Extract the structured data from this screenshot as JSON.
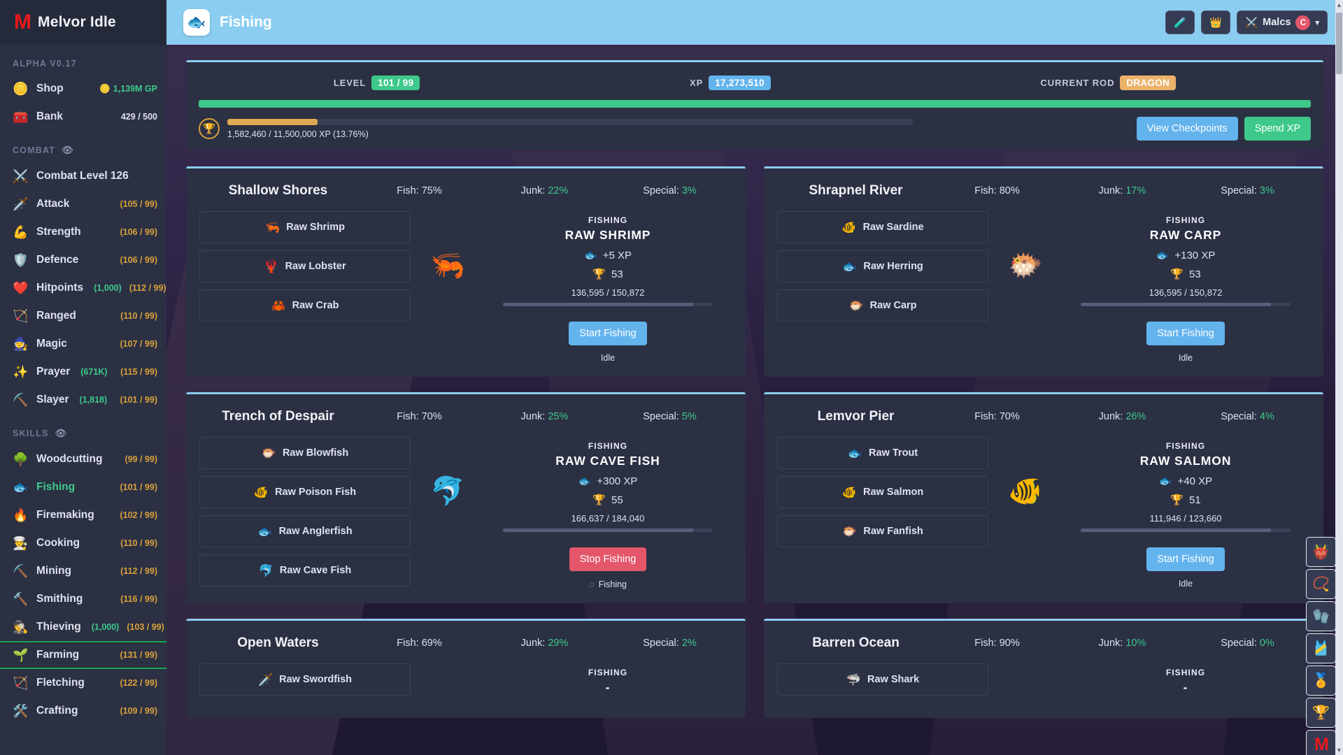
{
  "sidebar": {
    "brand": {
      "logo": "M",
      "title": "Melvor Idle"
    },
    "version": "ALPHA V0.17",
    "top_items": [
      {
        "icon": "🪙",
        "label": "Shop",
        "value": "1,139M GP",
        "value_icon": "🪙",
        "value_kind": "gp"
      },
      {
        "icon": "🧰",
        "label": "Bank",
        "value": "429 / 500",
        "value_kind": "count"
      }
    ],
    "combat_header": "COMBAT",
    "combat_items": [
      {
        "icon": "⚔️",
        "label": "Combat Level 126",
        "level": ""
      },
      {
        "icon": "🗡️",
        "label": "Attack",
        "level": "(105 / 99)"
      },
      {
        "icon": "💪",
        "label": "Strength",
        "level": "(106 / 99)"
      },
      {
        "icon": "🛡️",
        "label": "Defence",
        "level": "(106 / 99)"
      },
      {
        "icon": "❤️",
        "label": "Hitpoints",
        "mastery": "(1,000)",
        "level": "(112 / 99)"
      },
      {
        "icon": "🏹",
        "label": "Ranged",
        "level": "(110 / 99)"
      },
      {
        "icon": "🧙",
        "label": "Magic",
        "level": "(107 / 99)"
      },
      {
        "icon": "✨",
        "label": "Prayer",
        "mastery": "(671K)",
        "level": "(115 / 99)"
      },
      {
        "icon": "⛏️",
        "label": "Slayer",
        "mastery": "(1,818)",
        "level": "(101 / 99)"
      }
    ],
    "skills_header": "SKILLS",
    "skill_items": [
      {
        "icon": "🌳",
        "label": "Woodcutting",
        "level": "(99 / 99)"
      },
      {
        "icon": "🐟",
        "label": "Fishing",
        "level": "(101 / 99)",
        "selected": true
      },
      {
        "icon": "🔥",
        "label": "Firemaking",
        "level": "(102 / 99)"
      },
      {
        "icon": "👨‍🍳",
        "label": "Cooking",
        "level": "(110 / 99)"
      },
      {
        "icon": "⛏️",
        "label": "Mining",
        "level": "(112 / 99)"
      },
      {
        "icon": "🔨",
        "label": "Smithing",
        "level": "(116 / 99)"
      },
      {
        "icon": "🕵️",
        "label": "Thieving",
        "mastery": "(1,000)",
        "level": "(103 / 99)"
      },
      {
        "icon": "🌱",
        "label": "Farming",
        "level": "(131 / 99)",
        "active": true
      },
      {
        "icon": "🏹",
        "label": "Fletching",
        "level": "(122 / 99)"
      },
      {
        "icon": "🛠️",
        "label": "Crafting",
        "level": "(109 / 99)"
      }
    ]
  },
  "topbar": {
    "page_icon": "🐟",
    "page_title": "Fishing",
    "potion_button": "🧪",
    "crown_button": "👑",
    "account_icon": "⚔️",
    "account_name": "Malcs",
    "account_badge": "C",
    "caret": "▾"
  },
  "xp_panel": {
    "level_label": "LEVEL",
    "level_value": "101 / 99",
    "xp_label": "XP",
    "xp_value": "17,273,510",
    "rod_label": "CURRENT ROD",
    "rod_value": "DRAGON",
    "bar_percent": 100,
    "mastery_icon": "🏆",
    "mastery_text": "1,582,460 / 11,500,000 XP (13.76%)",
    "mastery_percent": 13.76,
    "view_checkpoints": "View Checkpoints",
    "spend_xp": "Spend XP"
  },
  "areas": [
    {
      "name": "Shallow Shores",
      "fish_label": "Fish:",
      "fish_value": "75%",
      "junk_label": "Junk:",
      "junk_value": "22%",
      "special_label": "Special:",
      "special_value": "3%",
      "fishes": [
        {
          "icon": "🦐",
          "label": "Raw Shrimp"
        },
        {
          "icon": "🦞",
          "label": "Raw Lobster"
        },
        {
          "icon": "🦀",
          "label": "Raw Crab"
        }
      ],
      "big_icon": "🦐",
      "kicker": "FISHING",
      "selected_name": "RAW SHRIMP",
      "xp_icon": "🐟",
      "xp_text": "+5 XP",
      "mastery_icon": "🏆",
      "mastery_level": "53",
      "mastery_progress": "136,595 / 150,872",
      "mastery_percent": 90.5,
      "button_label": "Start Fishing",
      "button_kind": "blue",
      "status": "Idle",
      "status_spinner": false
    },
    {
      "name": "Shrapnel River",
      "fish_label": "Fish:",
      "fish_value": "80%",
      "junk_label": "Junk:",
      "junk_value": "17%",
      "special_label": "Special:",
      "special_value": "3%",
      "fishes": [
        {
          "icon": "🐠",
          "label": "Raw Sardine"
        },
        {
          "icon": "🐟",
          "label": "Raw Herring"
        },
        {
          "icon": "🐡",
          "label": "Raw Carp"
        }
      ],
      "big_icon": "🐡",
      "kicker": "FISHING",
      "selected_name": "RAW CARP",
      "xp_icon": "🐟",
      "xp_text": "+130 XP",
      "mastery_icon": "🏆",
      "mastery_level": "53",
      "mastery_progress": "136,595 / 150,872",
      "mastery_percent": 90.5,
      "button_label": "Start Fishing",
      "button_kind": "blue",
      "status": "Idle",
      "status_spinner": false
    },
    {
      "name": "Trench of Despair",
      "fish_label": "Fish:",
      "fish_value": "70%",
      "junk_label": "Junk:",
      "junk_value": "25%",
      "special_label": "Special:",
      "special_value": "5%",
      "fishes": [
        {
          "icon": "🐡",
          "label": "Raw Blowfish"
        },
        {
          "icon": "🐠",
          "label": "Raw Poison Fish"
        },
        {
          "icon": "🐟",
          "label": "Raw Anglerfish"
        },
        {
          "icon": "🐬",
          "label": "Raw Cave Fish"
        }
      ],
      "big_icon": "🐬",
      "kicker": "FISHING",
      "selected_name": "RAW CAVE FISH",
      "xp_icon": "🐟",
      "xp_text": "+300 XP",
      "mastery_icon": "🏆",
      "mastery_level": "55",
      "mastery_progress": "166,637 / 184,040",
      "mastery_percent": 90.5,
      "button_label": "Stop Fishing",
      "button_kind": "red",
      "status": "Fishing",
      "status_spinner": true
    },
    {
      "name": "Lemvor Pier",
      "fish_label": "Fish:",
      "fish_value": "70%",
      "junk_label": "Junk:",
      "junk_value": "26%",
      "special_label": "Special:",
      "special_value": "4%",
      "fishes": [
        {
          "icon": "🐟",
          "label": "Raw Trout"
        },
        {
          "icon": "🐠",
          "label": "Raw Salmon"
        },
        {
          "icon": "🐡",
          "label": "Raw Fanfish"
        }
      ],
      "big_icon": "🐠",
      "kicker": "FISHING",
      "selected_name": "RAW SALMON",
      "xp_icon": "🐟",
      "xp_text": "+40 XP",
      "mastery_icon": "🏆",
      "mastery_level": "51",
      "mastery_progress": "111,946 / 123,660",
      "mastery_percent": 90.5,
      "button_label": "Start Fishing",
      "button_kind": "blue",
      "status": "Idle",
      "status_spinner": false
    },
    {
      "name": "Open Waters",
      "fish_label": "Fish:",
      "fish_value": "69%",
      "junk_label": "Junk:",
      "junk_value": "29%",
      "special_label": "Special:",
      "special_value": "2%",
      "fishes": [
        {
          "icon": "🗡️",
          "label": "Raw Swordfish"
        }
      ],
      "big_icon": "",
      "kicker": "FISHING",
      "selected_name": "-",
      "xp_icon": "",
      "xp_text": "",
      "mastery_icon": "",
      "mastery_level": "",
      "mastery_progress": "",
      "mastery_percent": 0,
      "button_label": "",
      "button_kind": "blue",
      "status": "",
      "status_spinner": false
    },
    {
      "name": "Barren Ocean",
      "fish_label": "Fish:",
      "fish_value": "90%",
      "junk_label": "Junk:",
      "junk_value": "10%",
      "special_label": "Special:",
      "special_value": "0%",
      "fishes": [
        {
          "icon": "🦈",
          "label": "Raw Shark"
        }
      ],
      "big_icon": "",
      "kicker": "FISHING",
      "selected_name": "-",
      "xp_icon": "",
      "xp_text": "",
      "mastery_icon": "",
      "mastery_level": "",
      "mastery_progress": "",
      "mastery_percent": 0,
      "button_label": "",
      "button_kind": "blue",
      "status": "",
      "status_spinner": false
    }
  ],
  "dock": [
    {
      "icon": "👹",
      "name": "combat-helmet"
    },
    {
      "icon": "📿",
      "name": "amulet"
    },
    {
      "icon": "🧤",
      "name": "gloves"
    },
    {
      "icon": "🎽",
      "name": "cape"
    },
    {
      "icon": "🏅",
      "name": "medal"
    },
    {
      "icon": "🏆",
      "name": "trophy"
    },
    {
      "icon": "M",
      "name": "melvor-logo"
    }
  ],
  "colors": {
    "accent_blue": "#8bcdf0",
    "green": "#3ec98a",
    "orange": "#edb26a",
    "red": "#e4566a",
    "panel": "#2b3043"
  }
}
